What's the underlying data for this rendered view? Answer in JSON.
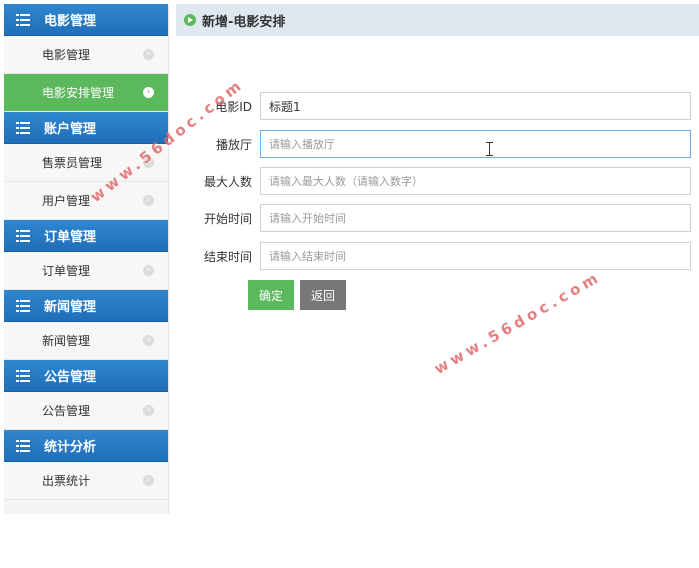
{
  "sidebar": {
    "groups": [
      {
        "title": "电影管理",
        "items": [
          "电影管理",
          "电影安排管理"
        ]
      },
      {
        "title": "账户管理",
        "items": [
          "售票员管理",
          "用户管理"
        ]
      },
      {
        "title": "订单管理",
        "items": [
          "订单管理"
        ]
      },
      {
        "title": "新闻管理",
        "items": [
          "新闻管理"
        ]
      },
      {
        "title": "公告管理",
        "items": [
          "公告管理"
        ]
      },
      {
        "title": "统计分析",
        "items": [
          "出票统计"
        ]
      }
    ],
    "active_item": "电影安排管理",
    "icons": {
      "group": "list-icon",
      "item": "chevron-right-circle-icon"
    }
  },
  "page": {
    "title": "新增-电影安排"
  },
  "form": {
    "fields": [
      {
        "label": "电影ID",
        "value": "标题1",
        "placeholder": ""
      },
      {
        "label": "播放厅",
        "value": "",
        "placeholder": "请输入播放厅"
      },
      {
        "label": "最大人数",
        "value": "",
        "placeholder": "请输入最大人数（请输入数字）"
      },
      {
        "label": "开始时间",
        "value": "",
        "placeholder": "请输入开始时间"
      },
      {
        "label": "结束时间",
        "value": "",
        "placeholder": "请输入结束时间"
      }
    ],
    "confirm_label": "确定",
    "back_label": "返回"
  },
  "watermark": "www.56doc.com",
  "colors": {
    "primary": "#2a7dc7",
    "active": "#5cb85c",
    "secondary": "#777777"
  }
}
